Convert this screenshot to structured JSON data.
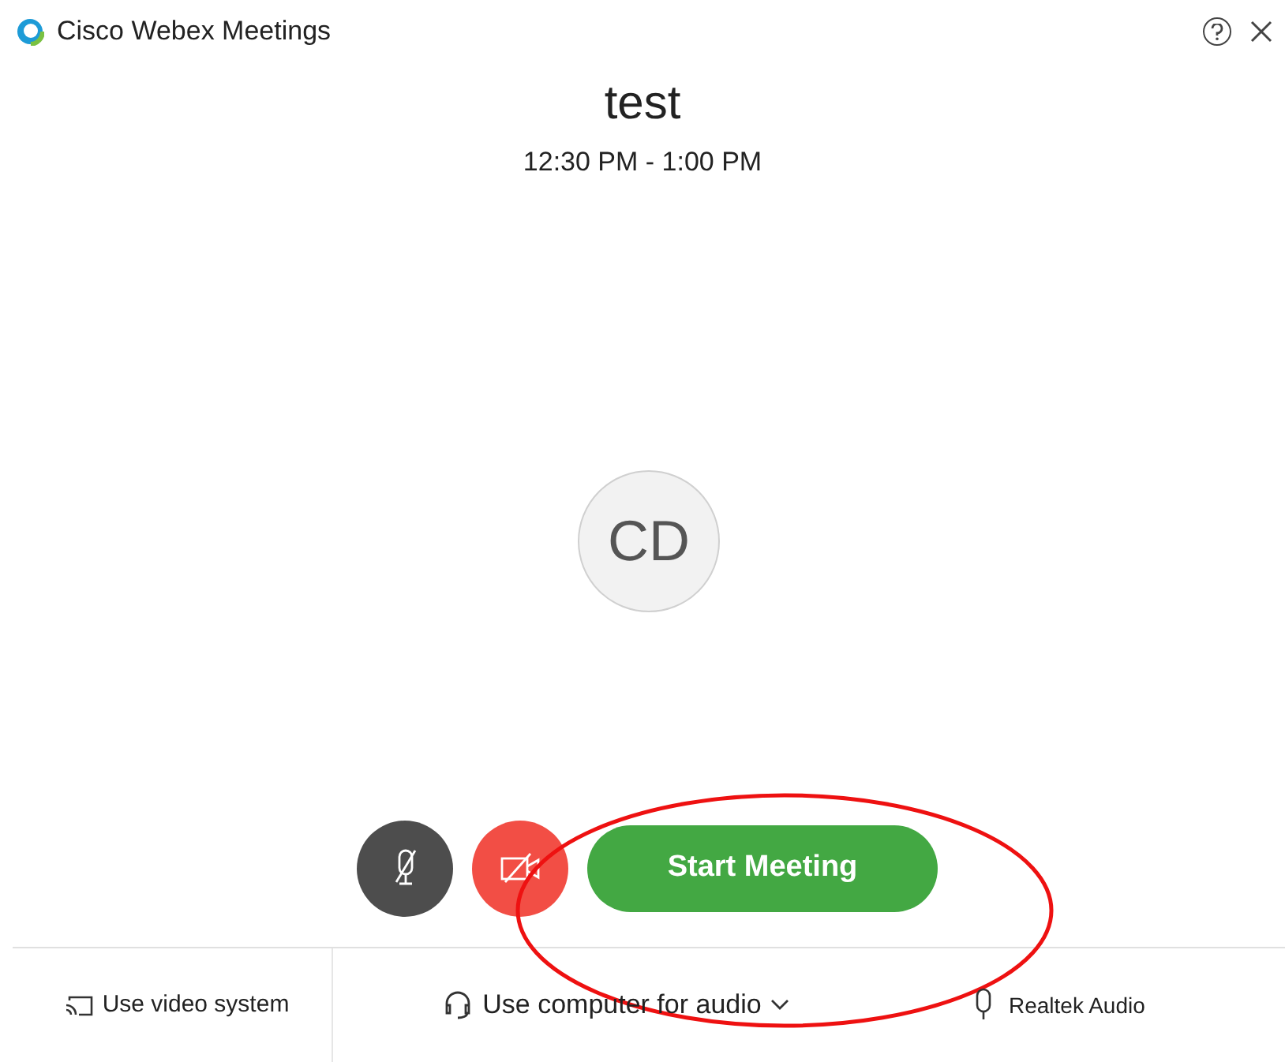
{
  "window": {
    "title": "Cisco Webex Meetings"
  },
  "meeting": {
    "title": "test",
    "time": "12:30 PM - 1:00 PM",
    "avatar_initials": "CD"
  },
  "controls": {
    "muted": true,
    "video_off": true,
    "start_button": "Start Meeting"
  },
  "footer": {
    "video_system": "Use video system",
    "audio": "Use computer for audio",
    "device": "Realtek Audio"
  }
}
